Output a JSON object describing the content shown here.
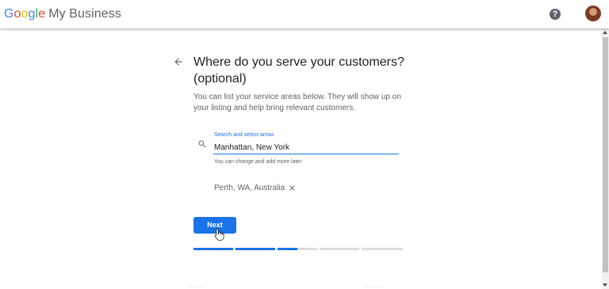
{
  "header": {
    "logo_parts": [
      "G",
      "o",
      "o",
      "g",
      "l",
      "e"
    ],
    "product_name": "My Business",
    "help_icon_glyph": "?",
    "icons": {
      "help": "help-circle-icon",
      "avatar": "user-avatar"
    }
  },
  "main": {
    "back_icon": "arrow-back-icon",
    "title": "Where do you serve your customers? (optional)",
    "description": "You can list your service areas below. They will show up on your listing and help bring relevant customers.",
    "search": {
      "label": "Search and select areas",
      "value": "Manhattan, New York",
      "helper": "You can change and add more later",
      "icon": "search-icon"
    },
    "selected_areas": [
      {
        "label": "Perth, WA, Australia",
        "remove_icon": "close-icon"
      }
    ],
    "next_label": "Next",
    "progress": {
      "segments": [
        1.0,
        1.0,
        0.5,
        0,
        0
      ],
      "active_color": "#1a73e8",
      "inactive_color": "#dadce0"
    }
  },
  "colors": {
    "accent": "#1a73e8",
    "text": "#202124",
    "secondary_text": "#5f6368"
  }
}
